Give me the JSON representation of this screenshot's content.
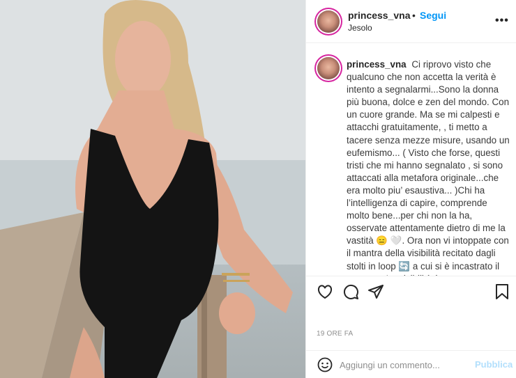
{
  "post": {
    "username": "princess_vna",
    "separator": "•",
    "follow_label": "Segui",
    "location": "Jesolo",
    "more_label": "•••",
    "caption_text": "Ci riprovo visto che qualcuno che non accetta la verità è intento a segnalarmi...Sono la donna più buona, dolce e zen del mondo. Con un cuore grande. Ma se mi calpesti e attacchi gratuitamente, , ti metto a tacere senza mezze misure, usando un eufemismo... ( Visto che forse, questi tristi che mi hanno segnalato , si sono attaccati alla metafora originale...che era molto piu’ esaustiva... )Chi ha l’intelligenza di capire, comprende molto bene...per chi non la ha, osservate attentamente dietro di me la vastità 😑 🤍. Ora non vi intoppate con il mantra della visibilità recitato dagli stolti in loop 🔄 a cui si è incastrato il neurone. La visibilità è una conseguenza dell’esposizione e di tutto ciò che è",
    "timestamp": "19 ORE FA",
    "comment_placeholder": "Aggiungi un commento...",
    "publish_label": "Pubblica"
  },
  "icons": {
    "like": "heart-icon",
    "comment": "comment-icon",
    "share": "share-icon",
    "save": "bookmark-icon",
    "emoji": "emoji-icon"
  },
  "colors": {
    "link_blue": "#0095f6",
    "publish_disabled": "#b2dffc",
    "muted": "#8e8e8e"
  }
}
